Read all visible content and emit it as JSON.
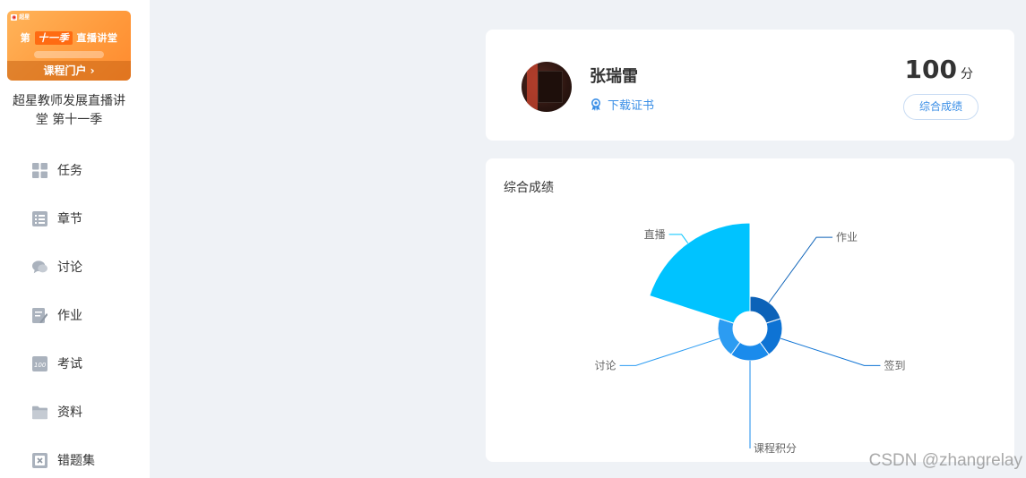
{
  "sidebar": {
    "banner": {
      "logo": "超星",
      "headline_prefix": "第",
      "headline_highlight": "十一季",
      "headline_suffix": "直播讲堂",
      "portal_label": "课程门户 ›"
    },
    "course_title": "超星教师发展直播讲堂 第十一季",
    "items": [
      {
        "label": "任务",
        "icon": "grid-icon"
      },
      {
        "label": "章节",
        "icon": "list-icon"
      },
      {
        "label": "讨论",
        "icon": "chat-bubble-icon"
      },
      {
        "label": "作业",
        "icon": "edit-document-icon"
      },
      {
        "label": "考试",
        "icon": "exam-icon"
      },
      {
        "label": "资料",
        "icon": "folder-icon"
      },
      {
        "label": "错题集",
        "icon": "wrong-questions-icon"
      }
    ]
  },
  "profile": {
    "name": "张瑞雷",
    "download_label": "下载证书",
    "score": "100",
    "score_unit": "分",
    "score_button": "综合成绩"
  },
  "chart_title": "综合成绩",
  "chart_data": {
    "type": "pie",
    "variant": "nightingale-rose",
    "slices": [
      {
        "name": "作业",
        "value": 10,
        "color": "#0c62b8"
      },
      {
        "name": "签到",
        "value": 10,
        "color": "#0e73d4"
      },
      {
        "name": "课程积分",
        "value": 10,
        "color": "#1a8bec"
      },
      {
        "name": "讨论",
        "value": 10,
        "color": "#2c9cf2"
      },
      {
        "name": "直播",
        "value": 60,
        "color": "#00c3ff"
      }
    ]
  },
  "watermark": "CSDN @zhangrelay"
}
